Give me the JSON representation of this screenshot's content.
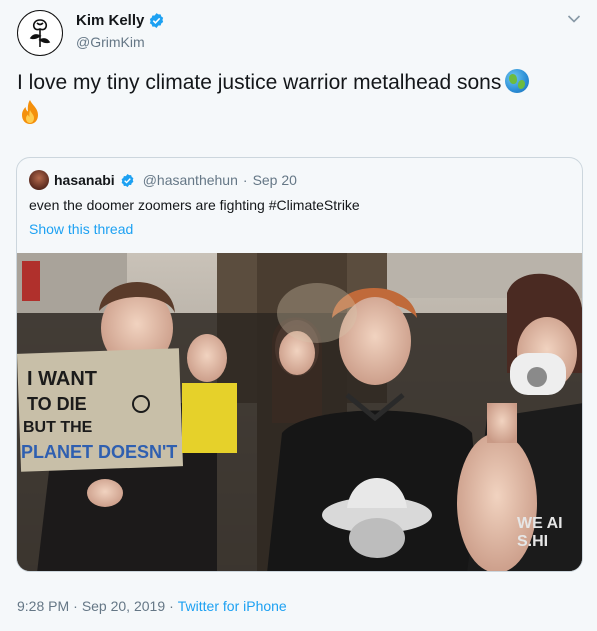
{
  "author": {
    "name": "Kim Kelly",
    "handle": "@GrimKim",
    "avatar_icon": "rose-icon",
    "verified_icon": "verified-badge-icon"
  },
  "tweet": {
    "text": "I love my tiny climate justice warrior metalhead sons",
    "emojis": [
      "globe-emoji",
      "fire-emoji"
    ]
  },
  "quoted": {
    "name": "hasanabi",
    "handle": "@hasanthehun",
    "separator": "·",
    "date": "Sep 20",
    "text": "even the doomer zoomers are fighting #ClimateStrike",
    "show_thread": "Show this thread",
    "sign_text": [
      "I WANT",
      "TO DIE",
      "BUT THE",
      "PLANET DOESN'T"
    ],
    "sweater_text": "WE AI\nS.HI"
  },
  "meta": {
    "time": "9:28 PM",
    "sep1": "·",
    "date": "Sep 20, 2019",
    "sep2": "·",
    "source": "Twitter for iPhone"
  },
  "colors": {
    "link": "#1da1f2",
    "secondary": "#657786",
    "verified": "#1da1f2",
    "border": "#ccd6dd"
  }
}
